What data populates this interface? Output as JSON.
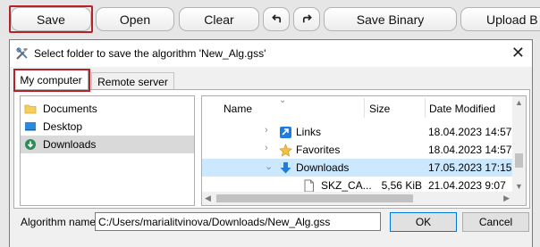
{
  "toolbar": {
    "save": "Save",
    "open": "Open",
    "clear": "Clear",
    "undo_icon": "undo-arrow-icon",
    "redo_icon": "redo-arrow-icon",
    "save_binary": "Save Binary",
    "upload": "Upload B"
  },
  "dialog": {
    "title": "Select folder to save the algorithm 'New_Alg.gss'",
    "tabs": [
      "My computer",
      "Remote server"
    ],
    "left_items": [
      {
        "label": "Documents",
        "icon": "folder-icon"
      },
      {
        "label": "Desktop",
        "icon": "desktop-icon"
      },
      {
        "label": "Downloads",
        "icon": "download-icon",
        "selected": true
      }
    ],
    "columns": {
      "name": "Name",
      "size": "Size",
      "date": "Date Modified"
    },
    "rows": [
      {
        "name": "Links",
        "size": "",
        "date": "18.04.2023 14:57",
        "icon": "links-icon",
        "expander": "collapsed"
      },
      {
        "name": "Favorites",
        "size": "",
        "date": "18.04.2023 14:57",
        "icon": "star-icon",
        "expander": "collapsed"
      },
      {
        "name": "Downloads",
        "size": "",
        "date": "17.05.2023 17:15",
        "icon": "download-arrow-icon",
        "expander": "expanded",
        "selected": true
      },
      {
        "name": "SKZ_CA...",
        "size": "5,56 KiB",
        "date": "21.04.2023 9:07",
        "icon": "file-icon",
        "expander": "none"
      }
    ],
    "algorithm_name_label": "Algorithm name:",
    "algorithm_name_value": "C:/Users/marialitvinova/Downloads/New_Alg.gss",
    "ok": "OK",
    "cancel": "Cancel"
  },
  "colors": {
    "highlight": "#b5222a",
    "selection": "#cce8ff",
    "accent": "#0078d7"
  }
}
